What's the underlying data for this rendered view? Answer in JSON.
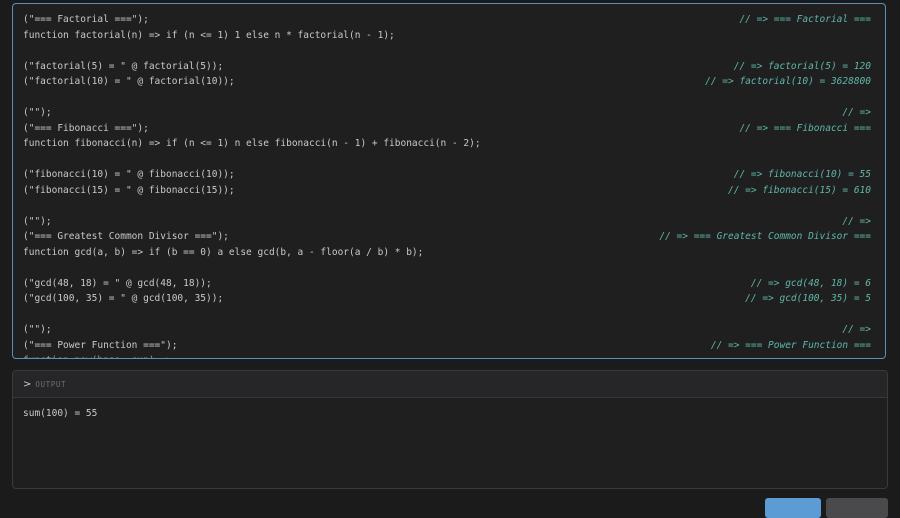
{
  "editor": {
    "lines": [
      {
        "code": "(\"=== Factorial ===\");",
        "result": "// => === Factorial ==="
      },
      {
        "code": "function factorial(n) => if (n <= 1) 1 else n * factorial(n - 1);",
        "result": ""
      },
      {
        "code": "",
        "result": ""
      },
      {
        "code": "(\"factorial(5) = \" @ factorial(5));",
        "result": "// => factorial(5) = 120"
      },
      {
        "code": "(\"factorial(10) = \" @ factorial(10));",
        "result": "// => factorial(10) = 3628800"
      },
      {
        "code": "",
        "result": ""
      },
      {
        "code": "(\"\");",
        "result": "// =>"
      },
      {
        "code": "(\"=== Fibonacci ===\");",
        "result": "// => === Fibonacci ==="
      },
      {
        "code": "function fibonacci(n) => if (n <= 1) n else fibonacci(n - 1) + fibonacci(n - 2);",
        "result": ""
      },
      {
        "code": "",
        "result": ""
      },
      {
        "code": "(\"fibonacci(10) = \" @ fibonacci(10));",
        "result": "// => fibonacci(10) = 55"
      },
      {
        "code": "(\"fibonacci(15) = \" @ fibonacci(15));",
        "result": "// => fibonacci(15) = 610"
      },
      {
        "code": "",
        "result": ""
      },
      {
        "code": "(\"\");",
        "result": "// =>"
      },
      {
        "code": "(\"=== Greatest Common Divisor ===\");",
        "result": "// => === Greatest Common Divisor ==="
      },
      {
        "code": "function gcd(a, b) => if (b == 0) a else gcd(b, a - floor(a / b) * b);",
        "result": ""
      },
      {
        "code": "",
        "result": ""
      },
      {
        "code": "(\"gcd(48, 18) = \" @ gcd(48, 18));",
        "result": "// => gcd(48, 18) = 6"
      },
      {
        "code": "(\"gcd(100, 35) = \" @ gcd(100, 35));",
        "result": "// => gcd(100, 35) = 5"
      },
      {
        "code": "",
        "result": ""
      },
      {
        "code": "(\"\");",
        "result": "// =>"
      },
      {
        "code": "(\"=== Power Function ===\");",
        "result": "// => === Power Function ==="
      },
      {
        "code": "function pow(base, exp) =>",
        "result": ""
      }
    ]
  },
  "output": {
    "chevron": ">",
    "label": "OUTPUT",
    "text": "sum(100) = 55"
  },
  "buttons": {
    "run_label": "",
    "clear_label": ""
  }
}
